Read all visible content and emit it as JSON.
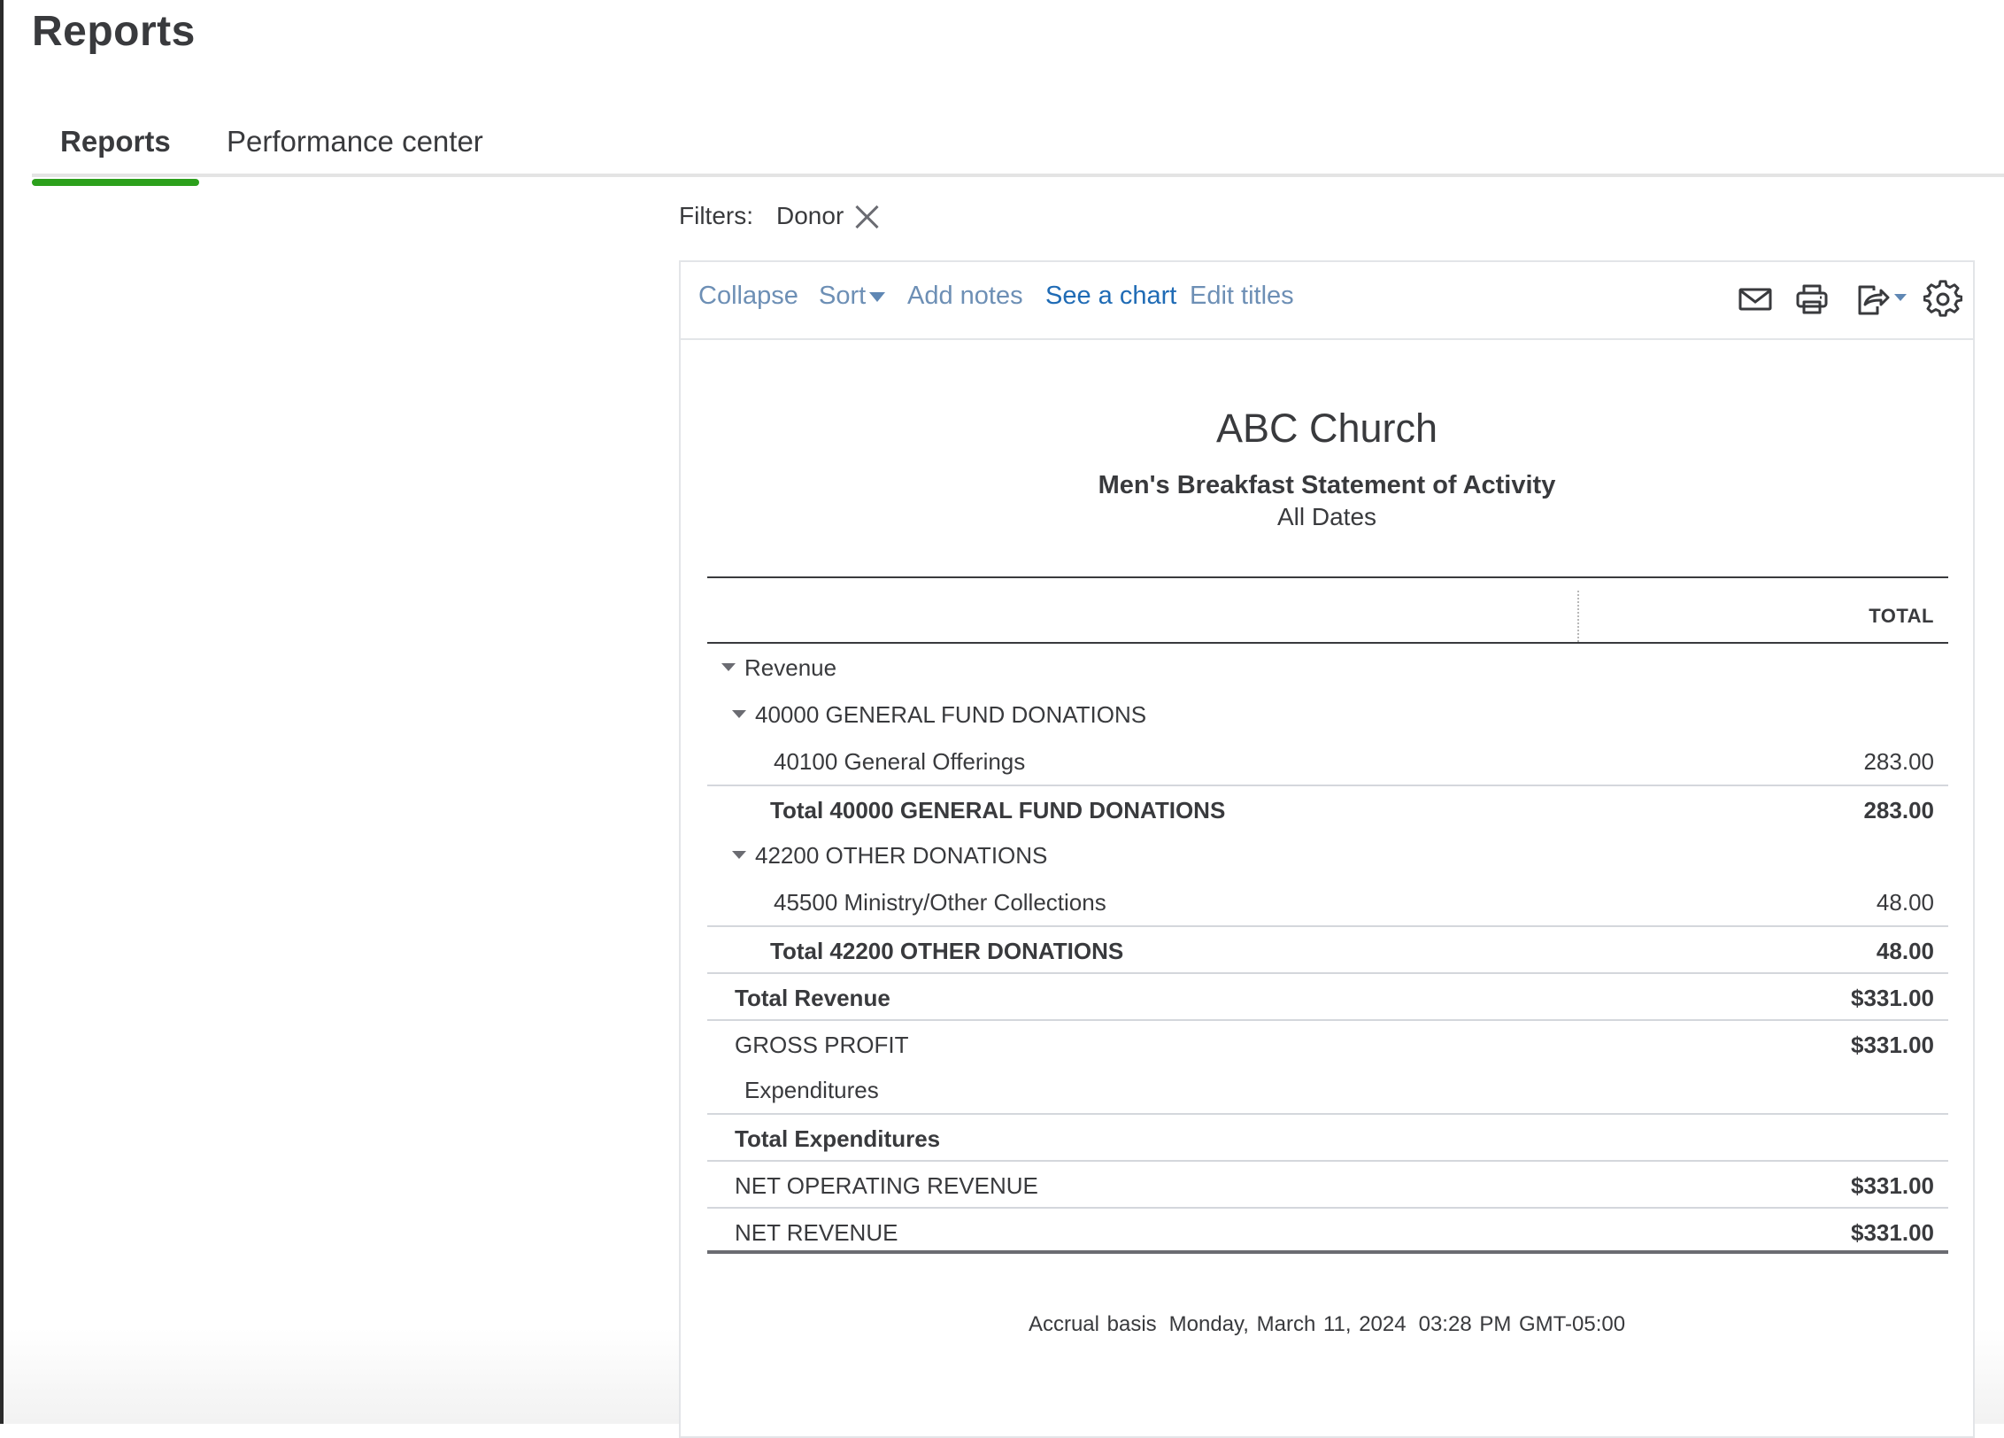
{
  "page": {
    "title": "Reports"
  },
  "tabs": [
    {
      "label": "Reports",
      "active": true
    },
    {
      "label": "Performance center",
      "active": false
    }
  ],
  "filters": {
    "label": "Filters:",
    "chip": "Donor"
  },
  "toolbar": {
    "collapse": "Collapse",
    "sort": "Sort",
    "add_notes": "Add notes",
    "see_chart": "See a chart",
    "edit_titles": "Edit titles",
    "icons": [
      "mail-icon",
      "print-icon",
      "export-icon",
      "gear-icon"
    ]
  },
  "report": {
    "company": "ABC Church",
    "title": "Men's Breakfast Statement of Activity",
    "dates": "All Dates",
    "column_header": "TOTAL",
    "rows": [
      {
        "label": "Revenue",
        "value": ""
      },
      {
        "label": "40000 GENERAL FUND DONATIONS",
        "value": ""
      },
      {
        "label": "40100 General Offerings",
        "value": "283.00"
      },
      {
        "label": "Total 40000 GENERAL FUND DONATIONS",
        "value": "283.00"
      },
      {
        "label": "42200 OTHER DONATIONS",
        "value": ""
      },
      {
        "label": "45500 Ministry/Other Collections",
        "value": "48.00"
      },
      {
        "label": "Total 42200 OTHER DONATIONS",
        "value": "48.00"
      },
      {
        "label": "Total Revenue",
        "value": "$331.00"
      },
      {
        "label": "GROSS PROFIT",
        "value": "$331.00"
      },
      {
        "label": "Expenditures",
        "value": ""
      },
      {
        "label": "Total Expenditures",
        "value": ""
      },
      {
        "label": "NET OPERATING REVENUE",
        "value": "$331.00"
      },
      {
        "label": "NET REVENUE",
        "value": "$331.00"
      }
    ],
    "footer": {
      "basis": "Accrual basis",
      "date": "Monday, March 11, 2024",
      "time": "03:28 PM GMT-05:00"
    }
  },
  "colors": {
    "accent_green": "#2ca01c",
    "link_blue": "#1f6bb5",
    "link_muted": "#6d8fb5",
    "text": "#393a3d"
  }
}
